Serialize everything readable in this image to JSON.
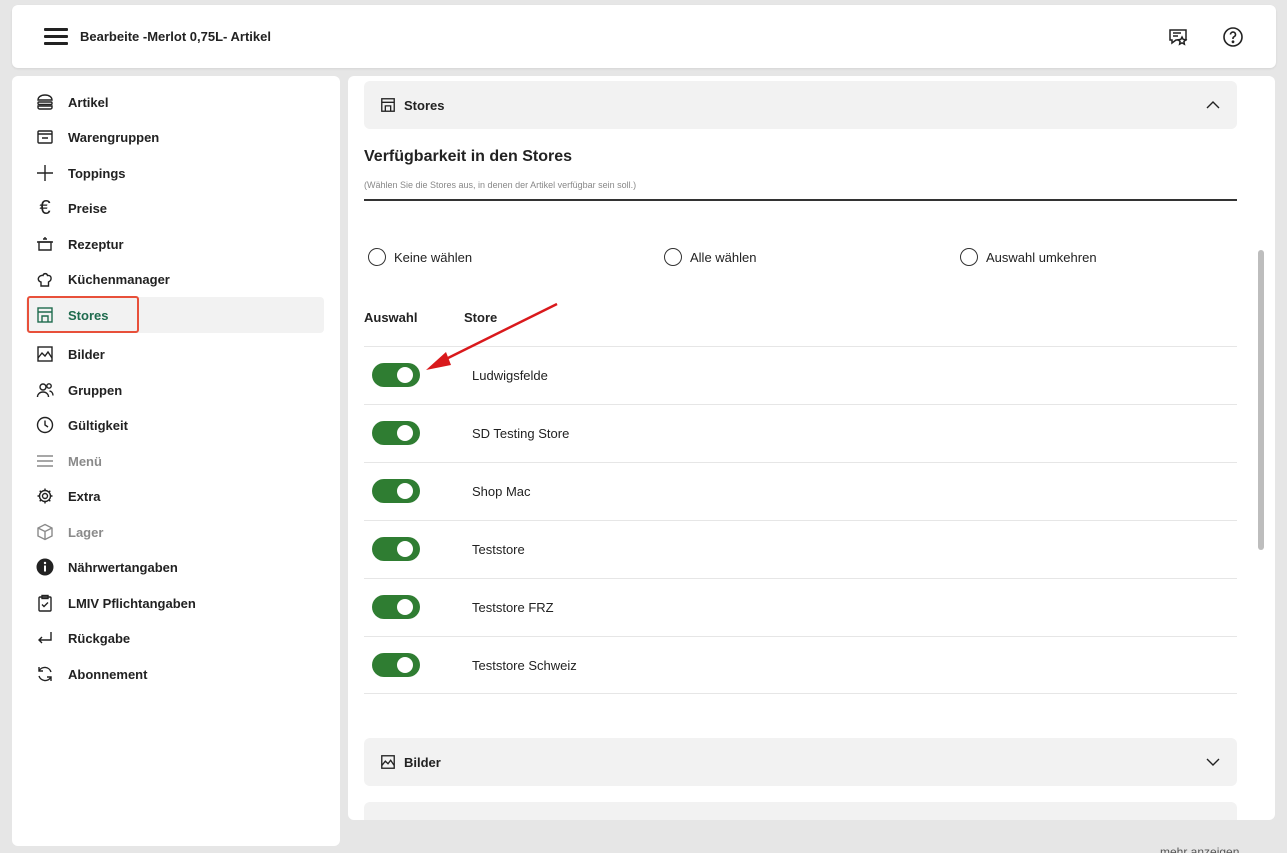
{
  "header": {
    "title": "Bearbeite -Merlot 0,75L- Artikel",
    "icons": [
      "menu-icon",
      "review-icon",
      "help-icon"
    ]
  },
  "sidebar": {
    "items": [
      {
        "label": "Artikel",
        "icon": "burger-icon"
      },
      {
        "label": "Warengruppen",
        "icon": "category-icon"
      },
      {
        "label": "Toppings",
        "icon": "plus-icon"
      },
      {
        "label": "Preise",
        "icon": "euro-icon"
      },
      {
        "label": "Rezeptur",
        "icon": "pot-icon"
      },
      {
        "label": "Küchenmanager",
        "icon": "chef-hat-icon"
      },
      {
        "label": "Stores",
        "icon": "store-icon",
        "active": true
      },
      {
        "label": "Bilder",
        "icon": "image-icon"
      },
      {
        "label": "Gruppen",
        "icon": "users-icon"
      },
      {
        "label": "Gültigkeit",
        "icon": "clock-icon"
      },
      {
        "label": "Menü",
        "icon": "lines-icon",
        "disabled": true
      },
      {
        "label": "Extra",
        "icon": "gear-icon"
      },
      {
        "label": "Lager",
        "icon": "box-icon",
        "disabled": true
      },
      {
        "label": "Nährwertangaben",
        "icon": "info-icon"
      },
      {
        "label": "LMIV Pflichtangaben",
        "icon": "clipboard-icon"
      },
      {
        "label": "Rückgabe",
        "icon": "return-icon"
      },
      {
        "label": "Abonnement",
        "icon": "refresh-icon"
      }
    ]
  },
  "main": {
    "stores_section": {
      "title": "Stores"
    },
    "heading": "Verfügbarkeit in den Stores",
    "hint": "(Wählen Sie die Stores aus, in denen der Artikel verfügbar sein soll.)",
    "options": [
      "Keine wählen",
      "Alle wählen",
      "Auswahl umkehren"
    ],
    "table": {
      "headers": [
        "Auswahl",
        "Store"
      ],
      "rows": [
        {
          "store": "Ludwigsfelde",
          "enabled": true
        },
        {
          "store": "SD Testing Store",
          "enabled": true
        },
        {
          "store": "Shop Mac",
          "enabled": true
        },
        {
          "store": "Teststore",
          "enabled": true
        },
        {
          "store": "Teststore FRZ",
          "enabled": true
        },
        {
          "store": "Teststore Schweiz",
          "enabled": true
        }
      ]
    },
    "bilder_section": {
      "title": "Bilder"
    }
  },
  "footer": {
    "more": "mehr anzeigen"
  },
  "colors": {
    "accent_active": "#1f6b4e",
    "toggle_on": "#2f7d32",
    "highlight": "#e8503a",
    "arrow": "#d9191c"
  }
}
